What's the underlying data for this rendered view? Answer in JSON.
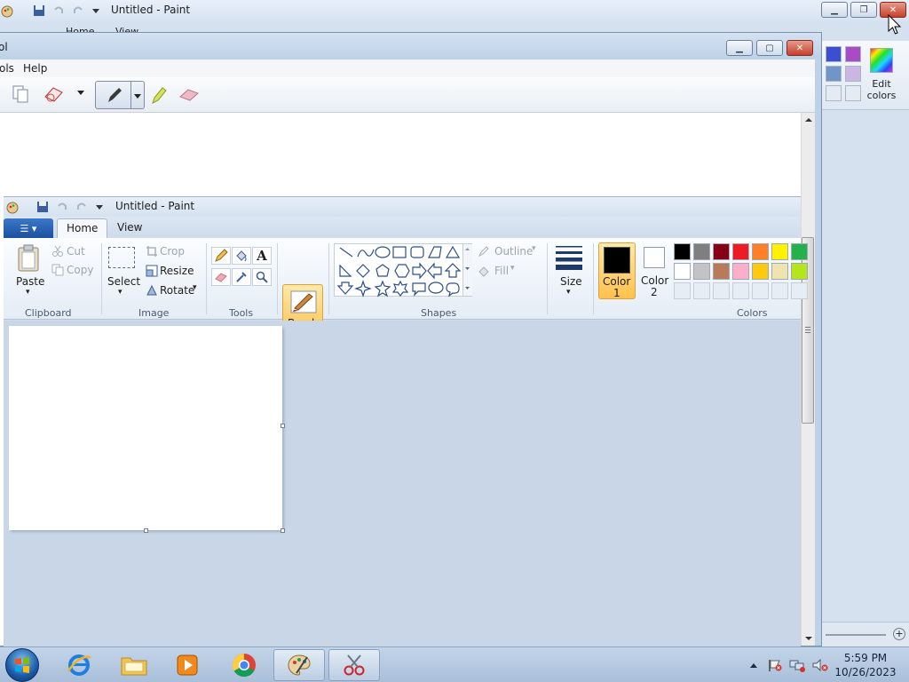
{
  "bg_window": {
    "title": "Untitled - Paint",
    "tabs": [
      "Home",
      "View"
    ],
    "edit_colors_label": "Edit colors",
    "swatches": [
      "#3b4fd0",
      "#a84bc4",
      "#6e97c8",
      "#cbb5e3",
      "#e5ebf2",
      "#e5ebf2"
    ]
  },
  "snip_window": {
    "title_partial": "ol",
    "menu": [
      "ols",
      "Help"
    ]
  },
  "paint_window": {
    "title": "Untitled - Paint",
    "tabs": {
      "home": "Home",
      "view": "View"
    },
    "clipboard": {
      "paste": "Paste",
      "cut": "Cut",
      "copy": "Copy",
      "group": "Clipboard"
    },
    "image": {
      "select": "Select",
      "crop": "Crop",
      "resize": "Resize",
      "rotate": "Rotate",
      "group": "Image"
    },
    "tools": {
      "group": "Tools"
    },
    "brushes": "Brushes",
    "shapes": {
      "outline": "Outline",
      "fill": "Fill",
      "group": "Shapes"
    },
    "size": "Size",
    "color1": {
      "line1": "Color",
      "line2": "1"
    },
    "color2": {
      "line1": "Color",
      "line2": "2"
    },
    "colors_group": "Colors",
    "palette_row1": [
      "#000000",
      "#7f7f7f",
      "#880015",
      "#ed1c24",
      "#ff7f27",
      "#fff200",
      "#22b14c"
    ],
    "palette_row2": [
      "#ffffff",
      "#c3c3c3",
      "#b97a57",
      "#ffaec9",
      "#ffc90e",
      "#efe4b0",
      "#b5e61d"
    ]
  },
  "taskbar": {
    "time": "5:59 PM",
    "date": "10/26/2023"
  }
}
